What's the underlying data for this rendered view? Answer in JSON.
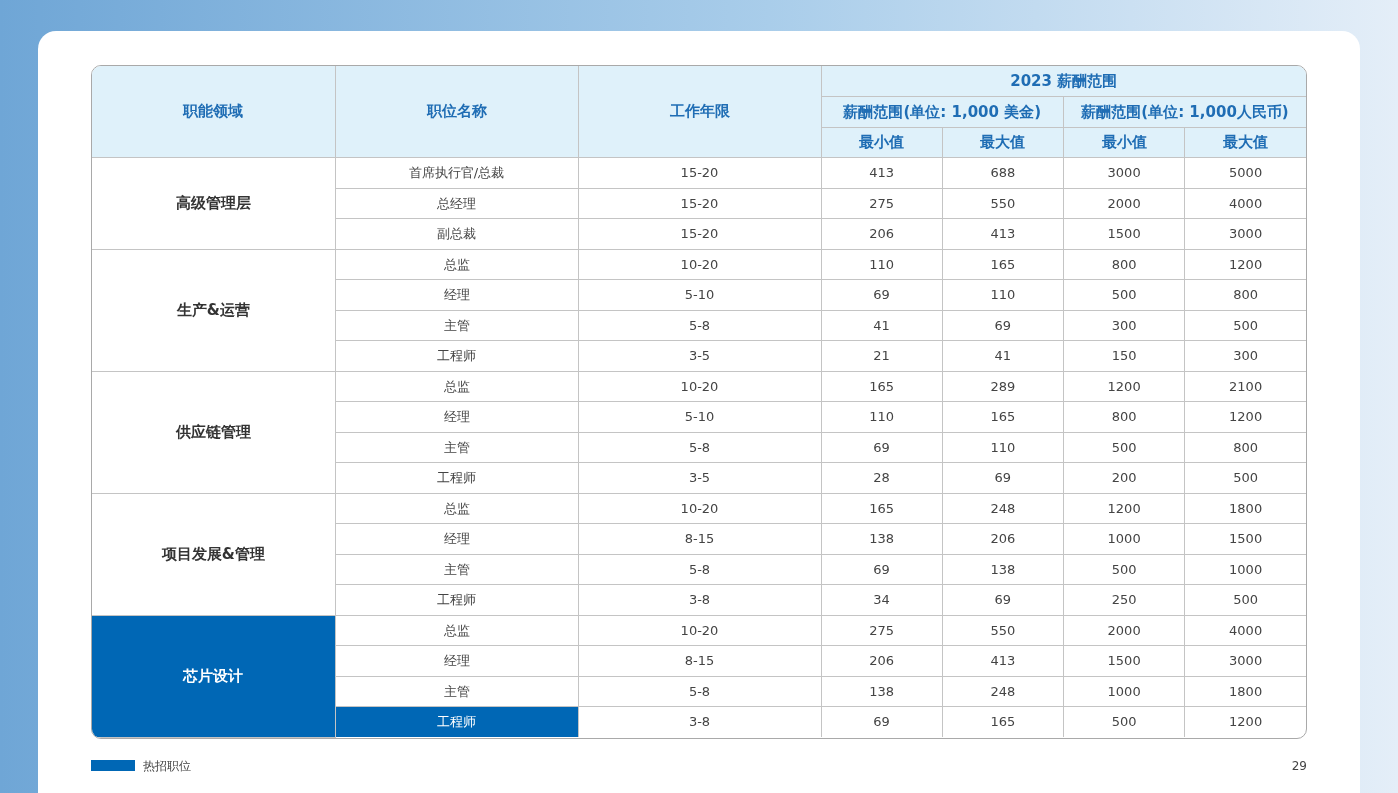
{
  "header": {
    "columns": [
      "职能领域",
      "职位名称",
      "工作年限"
    ],
    "group_title": "2023 薪酬范围",
    "currencies": [
      {
        "label": "薪酬范围(单位: 1,000 美金)",
        "columns": [
          "最小值",
          "最大值"
        ]
      },
      {
        "label": "薪酬范围(单位: 1,000人民币)",
        "columns": [
          "最小值",
          "最大值"
        ]
      }
    ]
  },
  "groups": [
    {
      "name": "高级管理层",
      "hot": false,
      "rows": [
        {
          "title": "首席执行官/总裁",
          "hot": false,
          "years": "15-20",
          "values": [
            "413",
            "688",
            "3000",
            "5000"
          ]
        },
        {
          "title": "总经理",
          "hot": false,
          "years": "15-20",
          "values": [
            "275",
            "550",
            "2000",
            "4000"
          ]
        },
        {
          "title": "副总裁",
          "hot": false,
          "years": "15-20",
          "values": [
            "206",
            "413",
            "1500",
            "3000"
          ]
        }
      ]
    },
    {
      "name": "生产&运营",
      "hot": false,
      "rows": [
        {
          "title": "总监",
          "hot": false,
          "years": "10-20",
          "values": [
            "110",
            "165",
            "800",
            "1200"
          ]
        },
        {
          "title": "经理",
          "hot": false,
          "years": "5-10",
          "values": [
            "69",
            "110",
            "500",
            "800"
          ]
        },
        {
          "title": "主管",
          "hot": false,
          "years": "5-8",
          "values": [
            "41",
            "69",
            "300",
            "500"
          ]
        },
        {
          "title": "工程师",
          "hot": false,
          "years": "3-5",
          "values": [
            "21",
            "41",
            "150",
            "300"
          ]
        }
      ]
    },
    {
      "name": "供应链管理",
      "hot": false,
      "rows": [
        {
          "title": "总监",
          "hot": false,
          "years": "10-20",
          "values": [
            "165",
            "289",
            "1200",
            "2100"
          ]
        },
        {
          "title": "经理",
          "hot": false,
          "years": "5-10",
          "values": [
            "110",
            "165",
            "800",
            "1200"
          ]
        },
        {
          "title": "主管",
          "hot": false,
          "years": "5-8",
          "values": [
            "69",
            "110",
            "500",
            "800"
          ]
        },
        {
          "title": "工程师",
          "hot": false,
          "years": "3-5",
          "values": [
            "28",
            "69",
            "200",
            "500"
          ]
        }
      ]
    },
    {
      "name": "项目发展&管理",
      "hot": false,
      "rows": [
        {
          "title": "总监",
          "hot": false,
          "years": "10-20",
          "values": [
            "165",
            "248",
            "1200",
            "1800"
          ]
        },
        {
          "title": "经理",
          "hot": false,
          "years": "8-15",
          "values": [
            "138",
            "206",
            "1000",
            "1500"
          ]
        },
        {
          "title": "主管",
          "hot": false,
          "years": "5-8",
          "values": [
            "69",
            "138",
            "500",
            "1000"
          ]
        },
        {
          "title": "工程师",
          "hot": false,
          "years": "3-8",
          "values": [
            "34",
            "69",
            "250",
            "500"
          ]
        }
      ]
    },
    {
      "name": "芯片设计",
      "hot": true,
      "rows": [
        {
          "title": "总监",
          "hot": false,
          "years": "10-20",
          "values": [
            "275",
            "550",
            "2000",
            "4000"
          ]
        },
        {
          "title": "经理",
          "hot": false,
          "years": "8-15",
          "values": [
            "206",
            "413",
            "1500",
            "3000"
          ]
        },
        {
          "title": "主管",
          "hot": false,
          "years": "5-8",
          "values": [
            "138",
            "248",
            "1000",
            "1800"
          ]
        },
        {
          "title": "工程师",
          "hot": true,
          "years": "3-8",
          "values": [
            "69",
            "165",
            "500",
            "1200"
          ]
        }
      ]
    }
  ],
  "legend": {
    "label": "热招职位"
  },
  "page_number": "29"
}
